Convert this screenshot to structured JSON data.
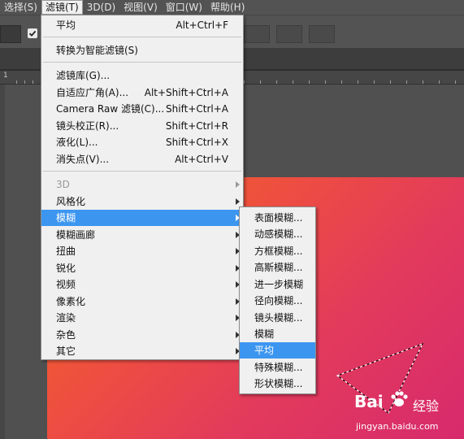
{
  "menubar": {
    "items": [
      "选择(S)",
      "滤镜(T)",
      "3D(D)",
      "视图(V)",
      "窗口(W)",
      "帮助(H)"
    ]
  },
  "ruler": {
    "label": "1"
  },
  "filter_menu": {
    "items": [
      {
        "label": "平均",
        "shortcut": "Alt+Ctrl+F"
      },
      {
        "label": "转换为智能滤镜(S)",
        "shortcut": ""
      },
      {
        "label": "滤镜库(G)...",
        "shortcut": ""
      },
      {
        "label": "自适应广角(A)...",
        "shortcut": "Alt+Shift+Ctrl+A"
      },
      {
        "label": "Camera Raw 滤镜(C)...",
        "shortcut": "Shift+Ctrl+A"
      },
      {
        "label": "镜头校正(R)...",
        "shortcut": "Shift+Ctrl+R"
      },
      {
        "label": "液化(L)...",
        "shortcut": "Shift+Ctrl+X"
      },
      {
        "label": "消失点(V)...",
        "shortcut": "Alt+Ctrl+V"
      },
      {
        "label": "3D"
      },
      {
        "label": "风格化"
      },
      {
        "label": "模糊"
      },
      {
        "label": "模糊画廊"
      },
      {
        "label": "扭曲"
      },
      {
        "label": "锐化"
      },
      {
        "label": "视频"
      },
      {
        "label": "像素化"
      },
      {
        "label": "渲染"
      },
      {
        "label": "杂色"
      },
      {
        "label": "其它"
      }
    ]
  },
  "blur_submenu": {
    "items": [
      "表面模糊...",
      "动感模糊...",
      "方框模糊...",
      "高斯模糊...",
      "进一步模糊",
      "径向模糊...",
      "镜头模糊...",
      "模糊",
      "平均",
      "特殊模糊...",
      "形状模糊..."
    ]
  },
  "watermark": {
    "brand_latin": "Bai",
    "brand_after": "经验",
    "url": "jingyan.baidu.com"
  },
  "colors": {
    "highlight": "#3c96f0",
    "menu_bg": "#f0f0f0",
    "ui_bg": "#535353",
    "canvas_start": "#f36b1e",
    "canvas_end": "#d72a6d"
  }
}
